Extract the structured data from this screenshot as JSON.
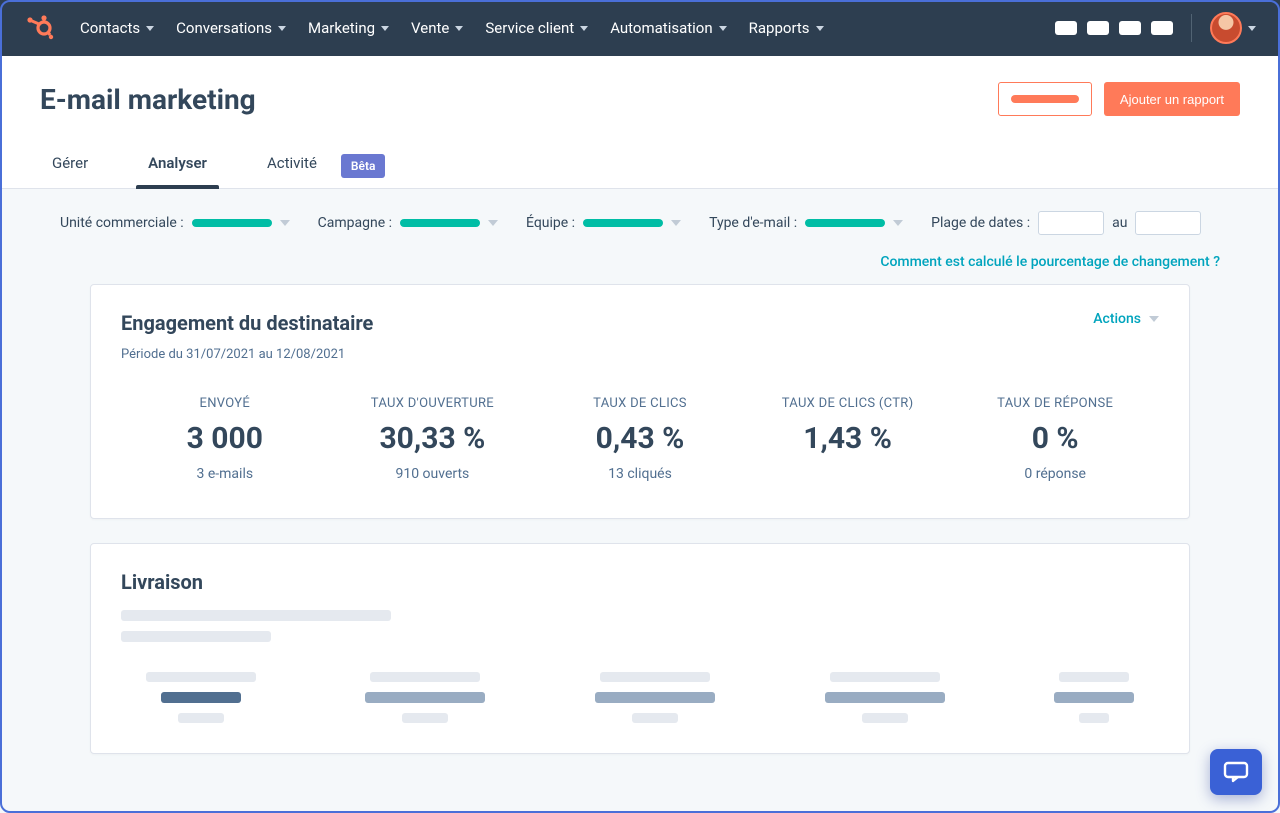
{
  "nav": {
    "items": [
      "Contacts",
      "Conversations",
      "Marketing",
      "Vente",
      "Service client",
      "Automatisation",
      "Rapports"
    ]
  },
  "page": {
    "title": "E-mail marketing",
    "add_report": "Ajouter un rapport"
  },
  "tabs": {
    "manage": "Gérer",
    "analyze": "Analyser",
    "activity": "Activité",
    "beta": "Bêta"
  },
  "filters": {
    "business_unit": "Unité commerciale :",
    "campaign": "Campagne :",
    "team": "Équipe :",
    "email_type": "Type d'e-mail :",
    "date_range": "Plage de dates :",
    "date_sep": "au"
  },
  "help_link": "Comment est calculé le pourcentage de changement ?",
  "engagement": {
    "title": "Engagement du destinataire",
    "period": "Période du 31/07/2021 au 12/08/2021",
    "actions": "Actions",
    "stats": [
      {
        "label": "ENVOYÉ",
        "value": "3 000",
        "sub": "3 e-mails"
      },
      {
        "label": "TAUX D'OUVERTURE",
        "value": "30,33 %",
        "sub": "910 ouverts"
      },
      {
        "label": "TAUX DE CLICS",
        "value": "0,43 %",
        "sub": "13 cliqués"
      },
      {
        "label": "TAUX DE CLICS (CTR)",
        "value": "1,43 %",
        "sub": ""
      },
      {
        "label": "TAUX DE RÉPONSE",
        "value": "0 %",
        "sub": "0 réponse"
      }
    ]
  },
  "delivery": {
    "title": "Livraison"
  },
  "colors": {
    "accent": "#ff7a59",
    "teal": "#00bda5",
    "link": "#00a4bd",
    "nav": "#2d3e50",
    "chat": "#3a61d6"
  }
}
